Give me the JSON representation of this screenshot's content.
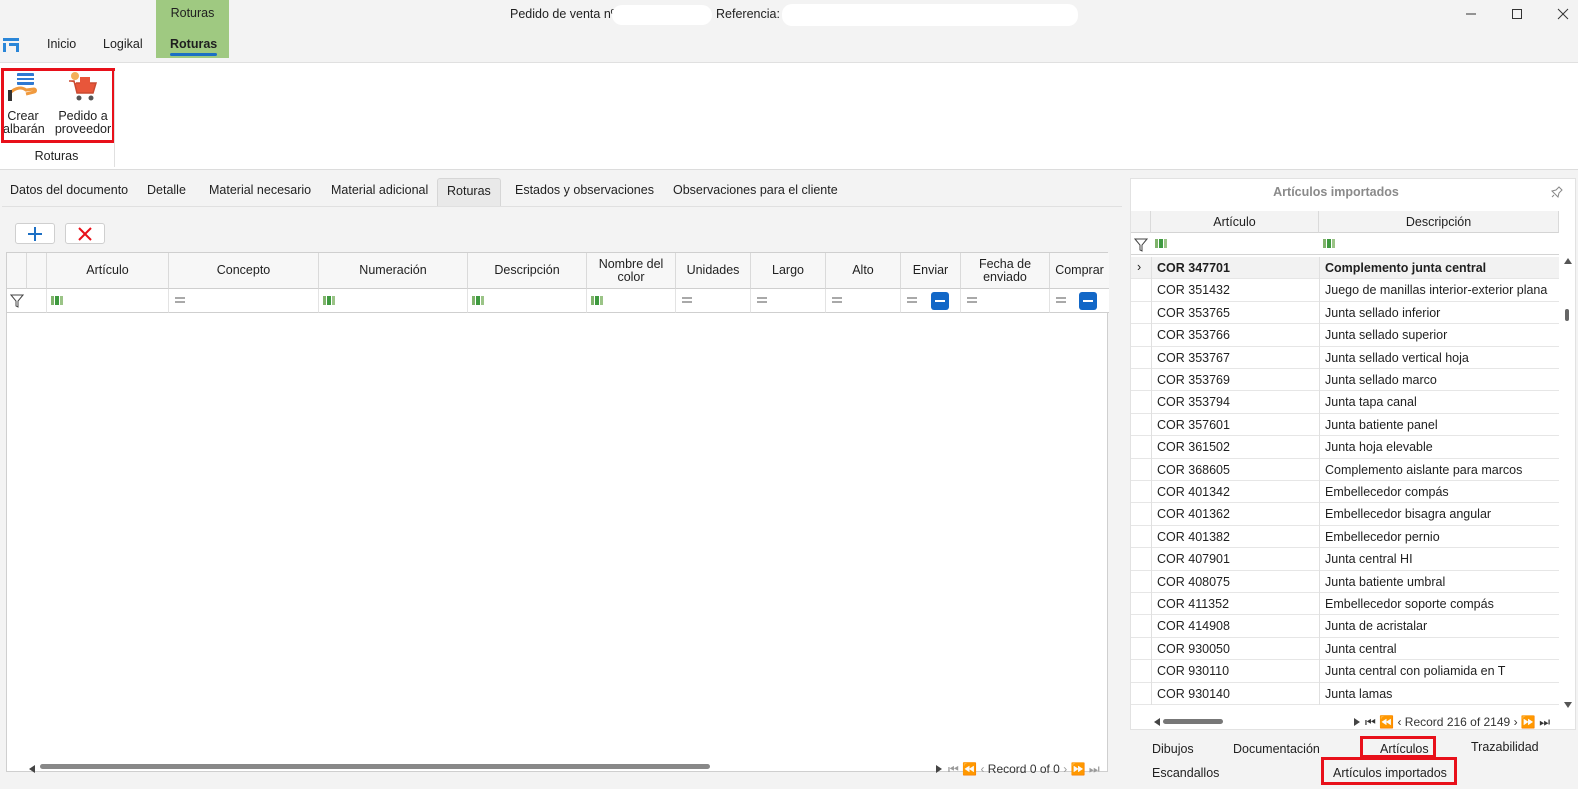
{
  "app": {
    "contextual_tab_group": "Roturas",
    "title_label": "Pedido de venta nº",
    "reference_label": "Referencia:",
    "ribbon_tabs": [
      "Inicio",
      "Logikal",
      "Roturas"
    ],
    "active_ribbon_tab": "Roturas"
  },
  "window_controls": {
    "minimize": "—",
    "maximize": "☐",
    "close": "✕"
  },
  "ribbon": {
    "group_label": "Roturas",
    "buttons": [
      {
        "label_line1": "Crear",
        "label_line2": "albarán",
        "icon": "delivery-note-icon"
      },
      {
        "label_line1": "Pedido a",
        "label_line2": "proveedor",
        "icon": "shopping-cart-icon"
      }
    ]
  },
  "doc_tabs": [
    "Datos del documento",
    "Detalle",
    "Material necesario",
    "Material adicional",
    "Roturas",
    "Estados y observaciones",
    "Observaciones para el cliente"
  ],
  "active_doc_tab": "Roturas",
  "toolbar": {
    "add_icon": "+",
    "delete_icon": "✕"
  },
  "grid": {
    "columns": [
      "Artículo",
      "Concepto",
      "Numeración",
      "Descripción",
      "Nombre del color",
      "Unidades",
      "Largo",
      "Alto",
      "Enviar",
      "Fecha de enviado",
      "Comprar"
    ],
    "pager_text": "Record 0 of 0"
  },
  "imported_panel": {
    "title": "Artículos importados",
    "columns": [
      "Artículo",
      "Descripción"
    ],
    "rows": [
      {
        "articulo": "COR 347701",
        "descripcion": "Complemento junta central"
      },
      {
        "articulo": "COR 351432",
        "descripcion": "Juego de manillas interior-exterior plana"
      },
      {
        "articulo": "COR 353765",
        "descripcion": "Junta sellado inferior"
      },
      {
        "articulo": "COR 353766",
        "descripcion": "Junta sellado superior"
      },
      {
        "articulo": "COR 353767",
        "descripcion": "Junta sellado vertical hoja"
      },
      {
        "articulo": "COR 353769",
        "descripcion": "Junta sellado marco"
      },
      {
        "articulo": "COR 353794",
        "descripcion": "Junta tapa canal"
      },
      {
        "articulo": "COR 357601",
        "descripcion": "Junta batiente panel"
      },
      {
        "articulo": "COR 361502",
        "descripcion": "Junta hoja elevable"
      },
      {
        "articulo": "COR 368605",
        "descripcion": "Complemento aislante para marcos"
      },
      {
        "articulo": "COR 401342",
        "descripcion": "Embellecedor compás"
      },
      {
        "articulo": "COR 401362",
        "descripcion": "Embellecedor bisagra angular"
      },
      {
        "articulo": "COR 401382",
        "descripcion": "Embellecedor pernio"
      },
      {
        "articulo": "COR 407901",
        "descripcion": "Junta central HI"
      },
      {
        "articulo": "COR 408075",
        "descripcion": "Junta batiente umbral"
      },
      {
        "articulo": "COR 411352",
        "descripcion": "Embellecedor soporte compás"
      },
      {
        "articulo": "COR 414908",
        "descripcion": "Junta de acristalar"
      },
      {
        "articulo": "COR 930050",
        "descripcion": "Junta central"
      },
      {
        "articulo": "COR 930110",
        "descripcion": "Junta central con poliamida en T"
      },
      {
        "articulo": "COR 930140",
        "descripcion": "Junta lamas"
      }
    ],
    "pager_text": "Record 216 of 2149"
  },
  "bottom_tabs": {
    "row1": [
      "Dibujos",
      "Documentación",
      "Artículos",
      "Trazabilidad"
    ],
    "row2": [
      "Escandallos",
      "Artículos importados"
    ]
  },
  "colors": {
    "accent": "#1c6fc4",
    "highlight": "#e8101a",
    "context_tab": "#9fc981"
  }
}
